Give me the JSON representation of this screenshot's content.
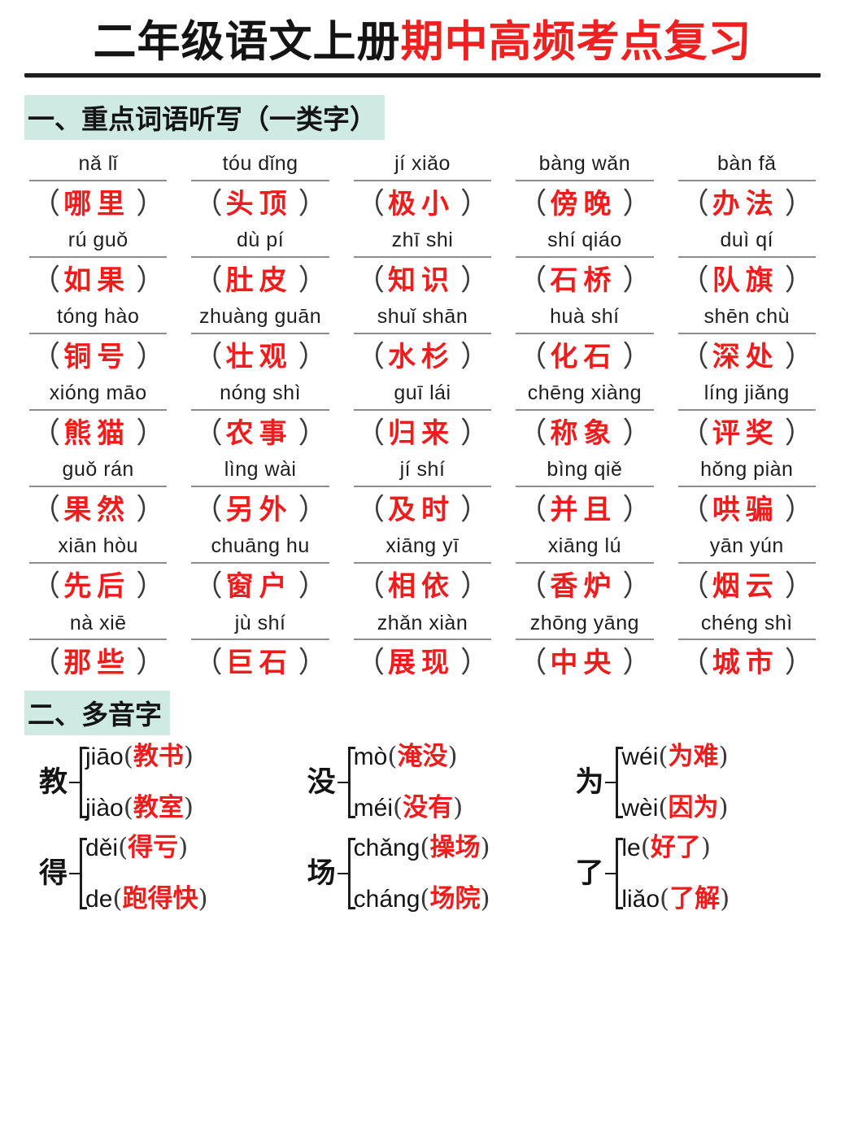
{
  "title": {
    "black_part": "二年级语文上册",
    "red_part": "期中高频考点复习"
  },
  "sections": {
    "one": {
      "heading": "一、重点词语听写（一类字）"
    },
    "two": {
      "heading": "二、多音字"
    }
  },
  "words": [
    [
      {
        "pinyin": "nǎ lǐ",
        "word": "哪里"
      },
      {
        "pinyin": "tóu dǐng",
        "word": "头顶"
      },
      {
        "pinyin": "jí xiǎo",
        "word": "极小"
      },
      {
        "pinyin": "bàng wǎn",
        "word": "傍晚"
      },
      {
        "pinyin": "bàn fǎ",
        "word": "办法"
      }
    ],
    [
      {
        "pinyin": "rú guǒ",
        "word": "如果"
      },
      {
        "pinyin": "dù pí",
        "word": "肚皮"
      },
      {
        "pinyin": "zhī  shi",
        "word": "知识"
      },
      {
        "pinyin": "shí qiáo",
        "word": "石桥"
      },
      {
        "pinyin": "duì qí",
        "word": "队旗"
      }
    ],
    [
      {
        "pinyin": "tóng hào",
        "word": "铜号"
      },
      {
        "pinyin": "zhuàng guān",
        "word": "壮观"
      },
      {
        "pinyin": "shuǐ shān",
        "word": "水杉"
      },
      {
        "pinyin": "huà shí",
        "word": "化石"
      },
      {
        "pinyin": "shēn chù",
        "word": "深处"
      }
    ],
    [
      {
        "pinyin": "xióng māo",
        "word": "熊猫"
      },
      {
        "pinyin": "nóng shì",
        "word": "农事"
      },
      {
        "pinyin": "guī  lái",
        "word": "归来"
      },
      {
        "pinyin": "chēng xiàng",
        "word": "称象"
      },
      {
        "pinyin": "líng jiǎng",
        "word": "评奖"
      }
    ],
    [
      {
        "pinyin": "guǒ rán",
        "word": "果然"
      },
      {
        "pinyin": "lìng wài",
        "word": "另外"
      },
      {
        "pinyin": "jí shí",
        "word": "及时"
      },
      {
        "pinyin": "bìng qiě",
        "word": "并且"
      },
      {
        "pinyin": "hǒng piàn",
        "word": "哄骗"
      }
    ],
    [
      {
        "pinyin": "xiān hòu",
        "word": "先后"
      },
      {
        "pinyin": "chuāng hu",
        "word": "窗户"
      },
      {
        "pinyin": "xiāng yī",
        "word": "相依"
      },
      {
        "pinyin": "xiāng lú",
        "word": "香炉"
      },
      {
        "pinyin": "yān yún",
        "word": "烟云"
      }
    ],
    [
      {
        "pinyin": "nà xiē",
        "word": "那些"
      },
      {
        "pinyin": "jù shí",
        "word": "巨石"
      },
      {
        "pinyin": "zhǎn xiàn",
        "word": "展现"
      },
      {
        "pinyin": "zhōng yāng",
        "word": "中央"
      },
      {
        "pinyin": "chéng shì",
        "word": "城市"
      }
    ]
  ],
  "polyphonic": [
    {
      "char": "教",
      "readings": [
        {
          "pinyin": "jiāo",
          "example": "教书"
        },
        {
          "pinyin": "jiào",
          "example": "教室"
        }
      ]
    },
    {
      "char": "没",
      "readings": [
        {
          "pinyin": "mò",
          "example": "淹没"
        },
        {
          "pinyin": "méi",
          "example": "没有"
        }
      ]
    },
    {
      "char": "为",
      "readings": [
        {
          "pinyin": "wéi",
          "example": "为难"
        },
        {
          "pinyin": "wèi",
          "example": "因为"
        }
      ]
    },
    {
      "char": "得",
      "readings": [
        {
          "pinyin": "děi",
          "example": "得亏"
        },
        {
          "pinyin": "de",
          "example": "跑得快"
        }
      ]
    },
    {
      "char": "场",
      "readings": [
        {
          "pinyin": "chǎng",
          "example": "操场"
        },
        {
          "pinyin": "cháng",
          "example": "场院"
        }
      ]
    },
    {
      "char": "了",
      "readings": [
        {
          "pinyin": "le",
          "example": "好了"
        },
        {
          "pinyin": "liǎo",
          "example": "了解"
        }
      ]
    }
  ],
  "colors": {
    "red": "#f01c1c",
    "highlight": "#cfe9e3",
    "rule": "#8d8d8d",
    "title_rule": "#1d1d1d"
  },
  "punctuation": {
    "paren_open": "（",
    "paren_close": "）",
    "paren_open_half": "(",
    "paren_close_half": ")"
  }
}
